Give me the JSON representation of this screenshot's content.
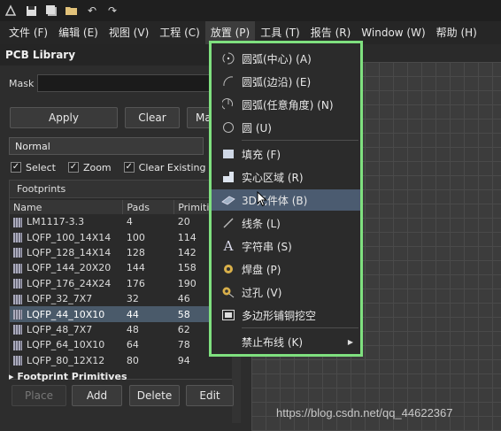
{
  "menubar": {
    "items": [
      "文件 (F)",
      "编辑 (E)",
      "视图 (V)",
      "工程 (C)",
      "放置 (P)",
      "工具 (T)",
      "报告 (R)",
      "Window (W)",
      "帮助 (H)"
    ]
  },
  "panel": {
    "title": "PCB Library",
    "mask_label": "Mask",
    "mask_value": "",
    "buttons": {
      "apply": "Apply",
      "clear": "Clear",
      "magnify": "Ma"
    },
    "filter_select": "Normal",
    "checks": {
      "select": "Select",
      "zoom": "Zoom",
      "clear_existing": "Clear Existing"
    },
    "footprints_title": "Footprints",
    "columns": [
      "Name",
      "Pads",
      "Primiti"
    ],
    "rows": [
      [
        "LM1117-3.3",
        "4",
        "20"
      ],
      [
        "LQFP_100_14X14",
        "100",
        "114"
      ],
      [
        "LQFP_128_14X14",
        "128",
        "142"
      ],
      [
        "LQFP_144_20X20",
        "144",
        "158"
      ],
      [
        "LQFP_176_24X24",
        "176",
        "190"
      ],
      [
        "LQFP_32_7X7",
        "32",
        "46"
      ],
      [
        "LQFP_44_10X10",
        "44",
        "58"
      ],
      [
        "LQFP_48_7X7",
        "48",
        "62"
      ],
      [
        "LQFP_64_10X10",
        "64",
        "78"
      ],
      [
        "LQFP_80_12X12",
        "80",
        "94"
      ]
    ],
    "selected_row": 6,
    "action_buttons": {
      "place": "Place",
      "add": "Add",
      "delete": "Delete",
      "edit": "Edit"
    },
    "primitives_title": "Footprint Primitives"
  },
  "dropdown": {
    "items": [
      {
        "label": "圆弧(中心) (A)",
        "icon": "arc-center-icon"
      },
      {
        "label": "圆弧(边沿) (E)",
        "icon": "arc-edge-icon"
      },
      {
        "label": "圆弧(任意角度) (N)",
        "icon": "arc-any-angle-icon"
      },
      {
        "label": "圆 (U)",
        "icon": "circle-icon"
      },
      {
        "label": "填充 (F)",
        "icon": "fill-icon"
      },
      {
        "label": "实心区域 (R)",
        "icon": "solid-region-icon"
      },
      {
        "label": "3D元件体 (B)",
        "icon": "3d-body-icon"
      },
      {
        "label": "线条 (L)",
        "icon": "line-icon"
      },
      {
        "label": "字符串 (S)",
        "icon": "string-icon"
      },
      {
        "label": "焊盘 (P)",
        "icon": "pad-icon"
      },
      {
        "label": "过孔 (V)",
        "icon": "via-icon"
      },
      {
        "label": "多边形铺铜挖空",
        "icon": "polygon-cutout-icon"
      },
      {
        "label": "禁止布线 (K)",
        "icon": ""
      }
    ],
    "highlighted": 6
  },
  "watermark": "https://blog.csdn.net/qq_44622367",
  "colors": {
    "menu_border": "#7fe07f",
    "highlight": "#4b5b70"
  }
}
